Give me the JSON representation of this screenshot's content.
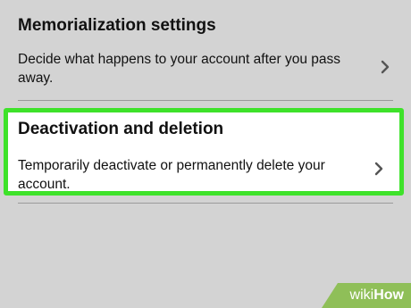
{
  "memorialization": {
    "title": "Memorialization settings",
    "description": "Decide what happens to your account after you pass away."
  },
  "deactivation": {
    "title": "Deactivation and deletion",
    "description": "Temporarily deactivate or permanently delete your account.",
    "highlight_color": "#3ee22a"
  },
  "watermark": {
    "wiki": "wiki",
    "how": "How"
  },
  "icons": {
    "chevron": "chevron-right-icon"
  }
}
